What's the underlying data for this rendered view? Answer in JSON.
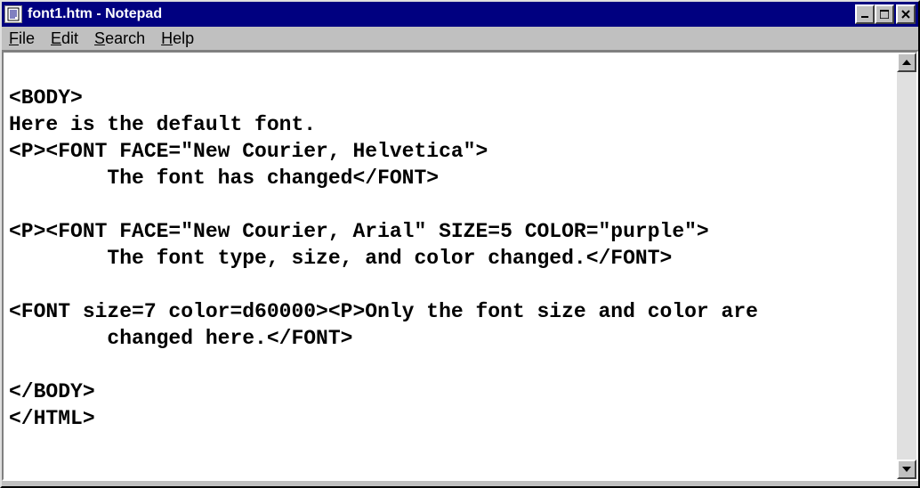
{
  "titlebar": {
    "title": "font1.htm - Notepad"
  },
  "menu": {
    "file": "File",
    "edit": "Edit",
    "search": "Search",
    "help": "Help"
  },
  "editor": {
    "content": "\n<BODY>\nHere is the default font.\n<P><FONT FACE=\"New Courier, Helvetica\">\n        The font has changed</FONT>\n\n<P><FONT FACE=\"New Courier, Arial\" SIZE=5 COLOR=\"purple\">\n        The font type, size, and color changed.</FONT>\n\n<FONT size=7 color=d60000><P>Only the font size and color are\n        changed here.</FONT>\n\n</BODY>\n</HTML>"
  },
  "colors": {
    "titlebar_bg": "#000080",
    "chrome_bg": "#c0c0c0",
    "editor_bg": "#ffffff"
  }
}
